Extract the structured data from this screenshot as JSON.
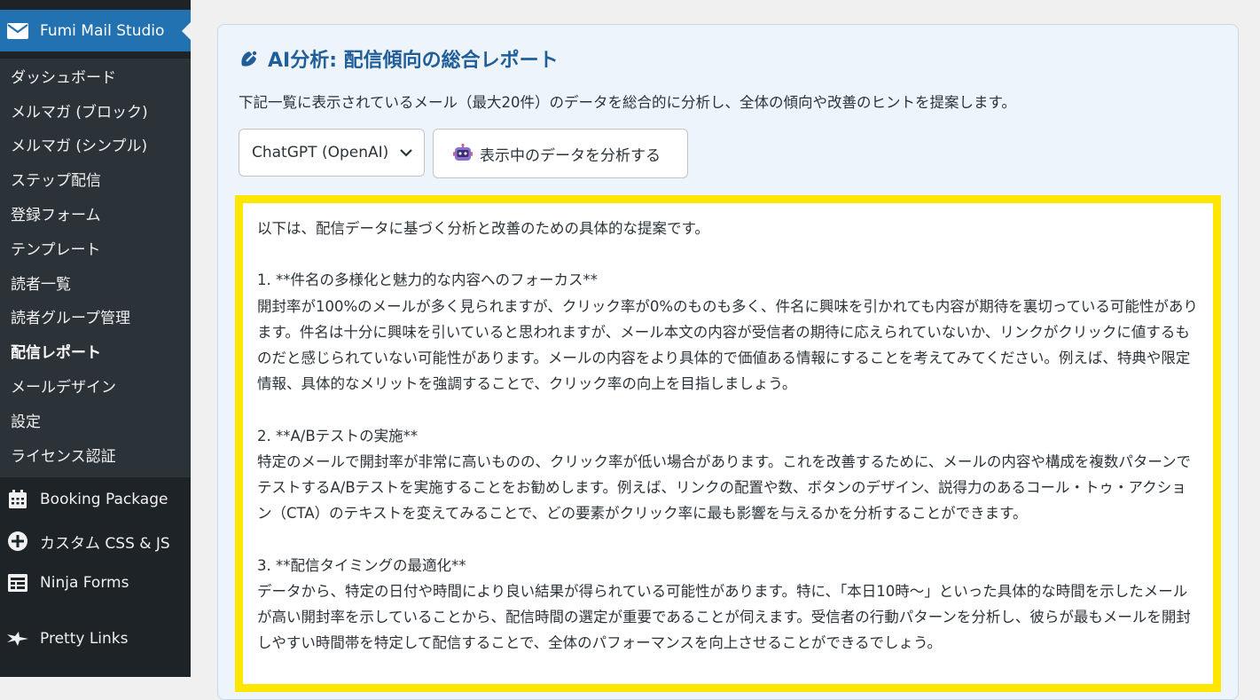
{
  "sidebar": {
    "current": {
      "label": "Fumi Mail Studio",
      "icon": "envelope-icon"
    },
    "submenu": [
      {
        "label": "ダッシュボード"
      },
      {
        "label": "メルマガ (ブロック)"
      },
      {
        "label": "メルマガ (シンプル)"
      },
      {
        "label": "ステップ配信"
      },
      {
        "label": "登録フォーム"
      },
      {
        "label": "テンプレート"
      },
      {
        "label": "読者一覧"
      },
      {
        "label": "読者グループ管理"
      },
      {
        "label": "配信レポート",
        "active": true
      },
      {
        "label": "メールデザイン"
      },
      {
        "label": "設定"
      },
      {
        "label": "ライセンス認証"
      }
    ],
    "menu": [
      {
        "label": "Booking Package",
        "icon": "calendar-icon"
      },
      {
        "label": "カスタム CSS & JS",
        "icon": "plus-circle-icon"
      },
      {
        "label": "Ninja Forms",
        "icon": "form-icon"
      },
      {
        "label": "Pretty Links",
        "icon": "star-link-icon"
      }
    ]
  },
  "panel": {
    "title": "AI分析: 配信傾向の総合レポート",
    "description": "下記一覧に表示されているメール（最大20件）のデータを総合的に分析し、全体の傾向や改善のヒントを提案します。",
    "model_select": {
      "value": "ChatGPT (OpenAI)"
    },
    "analyze_button": "表示中のデータを分析する",
    "result": "以下は、配信データに基づく分析と改善のための具体的な提案です。\n\n1. **件名の多様化と魅力的な内容へのフォーカス**\n開封率が100%のメールが多く見られますが、クリック率が0%のものも多く、件名に興味を引かれても内容が期待を裏切っている可能性があります。件名は十分に興味を引いていると思われますが、メール本文の内容が受信者の期待に応えられていないか、リンクがクリックに値するものだと感じられていない可能性があります。メールの内容をより具体的で価値ある情報にすることを考えてみてください。例えば、特典や限定情報、具体的なメリットを強調することで、クリック率の向上を目指しましょう。\n\n2. **A/Bテストの実施**\n特定のメールで開封率が非常に高いものの、クリック率が低い場合があります。これを改善するために、メールの内容や構成を複数パターンでテストするA/Bテストを実施することをお勧めします。例えば、リンクの配置や数、ボタンのデザイン、説得力のあるコール・トゥ・アクション（CTA）のテキストを変えてみることで、どの要素がクリック率に最も影響を与えるかを分析することができます。\n\n3. **配信タイミングの最適化**\nデータから、特定の日付や時間により良い結果が得られている可能性があります。特に、「本日10時〜」といった具体的な時間を示したメールが高い開封率を示していることから、配信時間の選定が重要であることが伺えます。受信者の行動パターンを分析し、彼らが最もメールを開封しやすい時間帯を特定して配信することで、全体のパフォーマンスを向上させることができるでしょう。"
  },
  "colors": {
    "sidebar_bg": "#1d2327",
    "submenu_bg": "#2c3338",
    "active_menu": "#2271b1",
    "title_blue": "#1f5e99",
    "highlight_border": "#ffe600"
  }
}
